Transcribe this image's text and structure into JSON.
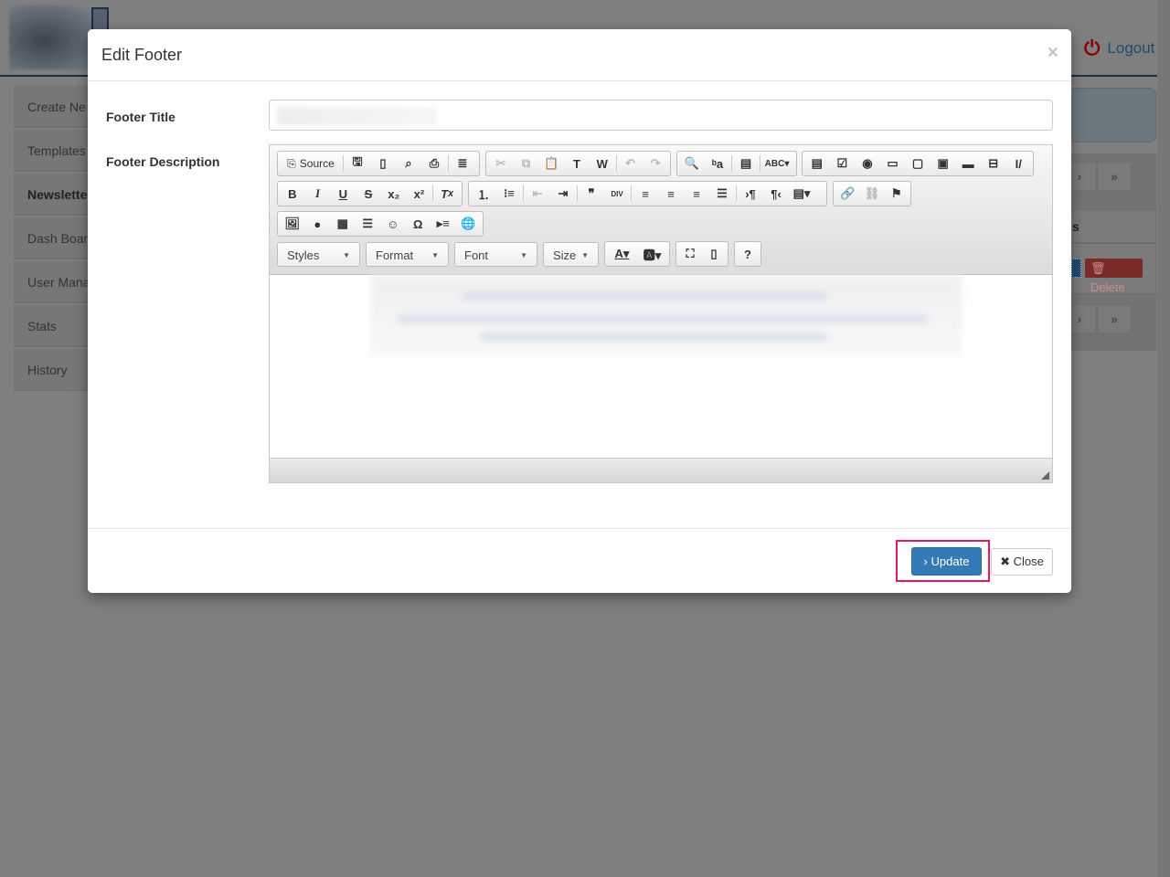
{
  "header": {
    "logout_label": "Logout"
  },
  "sidebar": {
    "items": [
      {
        "label": "Create Ne"
      },
      {
        "label": "Templates"
      },
      {
        "label": "Newslette"
      },
      {
        "label": "Dash Boar"
      },
      {
        "label": "User Mana"
      },
      {
        "label": "Stats"
      },
      {
        "label": "History"
      }
    ]
  },
  "background": {
    "column_header_fragment": "s",
    "delete_label": "Delete"
  },
  "modal": {
    "title": "Edit Footer",
    "close_x": "×",
    "footer_title_label": "Footer Title",
    "footer_description_label": "Footer Description",
    "footer_title_value": "",
    "editor": {
      "source_label": "Source",
      "combos": [
        "Styles",
        "Format",
        "Font",
        "Size"
      ]
    },
    "update_label": "Update",
    "close_label": "Close"
  },
  "colors": {
    "primary": "#337ab7",
    "highlight": "#e0186c",
    "danger": "#d9534f"
  }
}
